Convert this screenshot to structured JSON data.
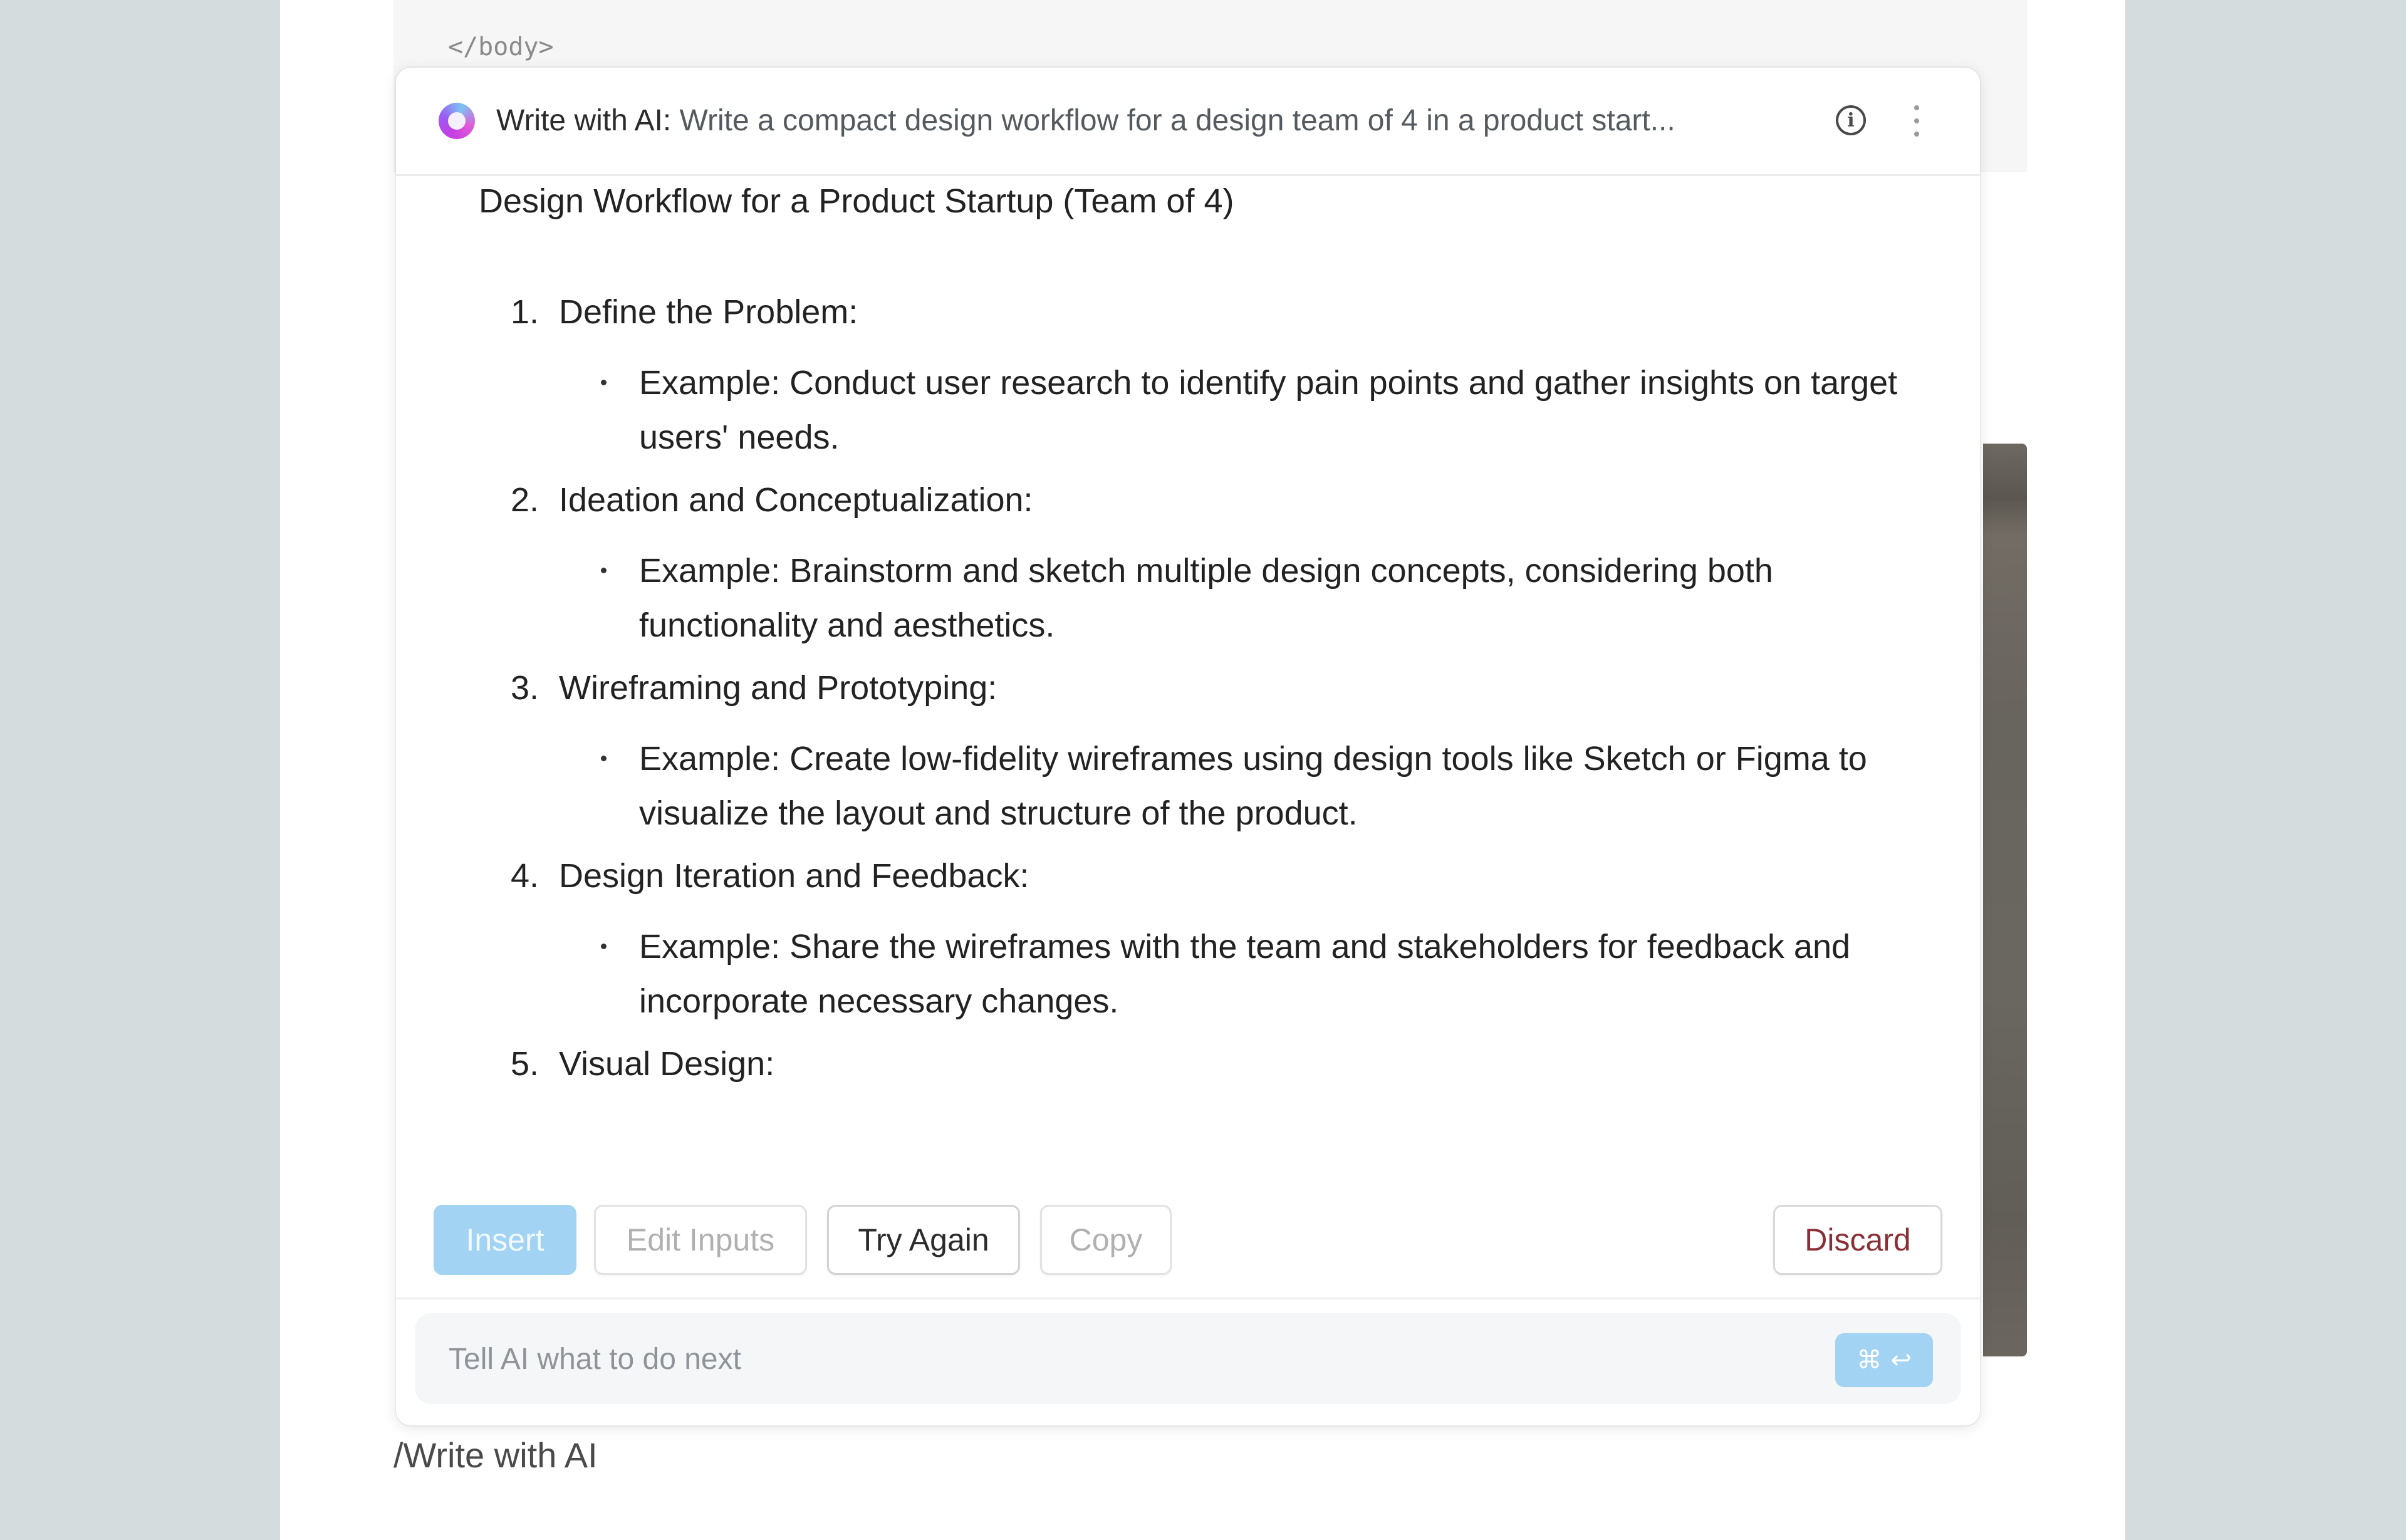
{
  "editor": {
    "code_line": "</body>",
    "slash_command": "/Write with AI"
  },
  "popup": {
    "header": {
      "label": "Write with AI:",
      "prompt": "Write a compact design workflow for a design team of 4 in a product start...",
      "info_icon": "info-icon",
      "more_icon": "more-vertical-icon",
      "logo_icon": "ai-logo-icon"
    },
    "document": {
      "title": "Design Workflow for a Product Startup (Team of 4)",
      "steps": [
        {
          "number": "1.",
          "label": "Define the Problem:",
          "example": "Example: Conduct user research to identify pain points and gather insights on target users' needs."
        },
        {
          "number": "2.",
          "label": "Ideation and Conceptualization:",
          "example": "Example: Brainstorm and sketch multiple design concepts, considering both functionality and aesthetics."
        },
        {
          "number": "3.",
          "label": "Wireframing and Prototyping:",
          "example": "Example: Create low-fidelity wireframes using design tools like Sketch or Figma to visualize the layout and structure of the product."
        },
        {
          "number": "4.",
          "label": "Design Iteration and Feedback:",
          "example": "Example: Share the wireframes with the team and stakeholders for feedback and incorporate necessary changes."
        },
        {
          "number": "5.",
          "label": "Visual Design:"
        }
      ]
    },
    "actions": {
      "insert": "Insert",
      "edit_inputs": "Edit Inputs",
      "try_again": "Try Again",
      "copy": "Copy",
      "discard": "Discard"
    },
    "input": {
      "placeholder": "Tell AI what to do next",
      "value": "",
      "send_shortcut_cmd": "⌘",
      "send_shortcut_enter": "↩"
    }
  },
  "colors": {
    "accent_button": "#a3d3f3",
    "discard_text": "#8a2f36",
    "background": "#d4dcde"
  }
}
